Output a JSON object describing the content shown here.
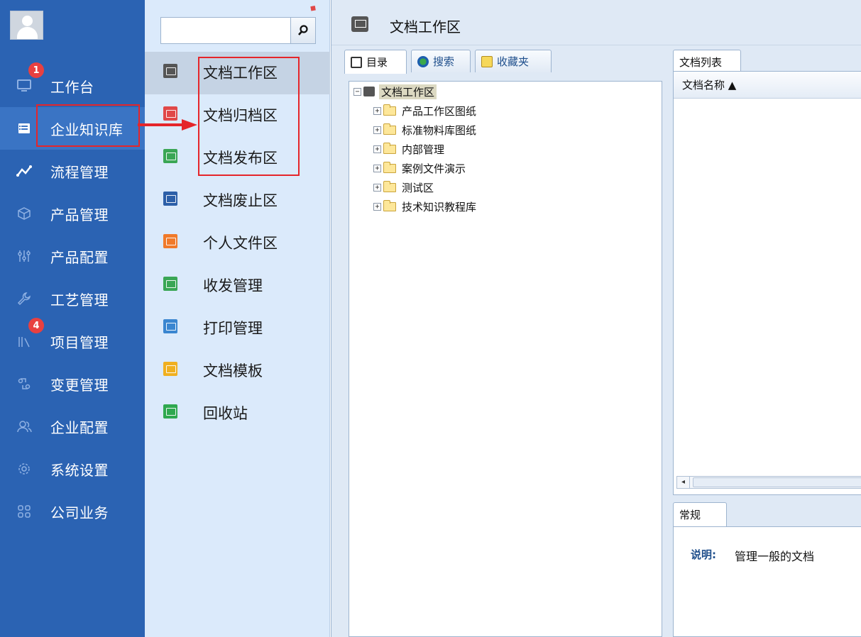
{
  "sidebar": {
    "items": [
      {
        "label": "工作台",
        "icon": "monitor-icon",
        "badge": "1"
      },
      {
        "label": "企业知识库",
        "icon": "book-icon"
      },
      {
        "label": "流程管理",
        "icon": "flow-icon"
      },
      {
        "label": "产品管理",
        "icon": "cube-icon"
      },
      {
        "label": "产品配置",
        "icon": "sliders-icon"
      },
      {
        "label": "工艺管理",
        "icon": "wrench-icon"
      },
      {
        "label": "项目管理",
        "icon": "chart-icon",
        "badge": "4"
      },
      {
        "label": "变更管理",
        "icon": "change-icon"
      },
      {
        "label": "企业配置",
        "icon": "users-icon"
      },
      {
        "label": "系统设置",
        "icon": "gear-icon"
      },
      {
        "label": "公司业务",
        "icon": "grid-icon"
      }
    ]
  },
  "submenu": {
    "search_value": "",
    "items": [
      {
        "label": "文档工作区",
        "icon": "monitor-icon",
        "color": "#555555"
      },
      {
        "label": "文档归档区",
        "icon": "archive-icon",
        "color": "#e04848"
      },
      {
        "label": "文档发布区",
        "icon": "publish-icon",
        "color": "#3aa655"
      },
      {
        "label": "文档废止区",
        "icon": "void-icon",
        "color": "#2c5fa8"
      },
      {
        "label": "个人文件区",
        "icon": "personal-icon",
        "color": "#f07a2a"
      },
      {
        "label": "收发管理",
        "icon": "inbox-icon",
        "color": "#3aa655"
      },
      {
        "label": "打印管理",
        "icon": "print-icon",
        "color": "#3a86d0"
      },
      {
        "label": "文档模板",
        "icon": "template-icon",
        "color": "#f0b020"
      },
      {
        "label": "回收站",
        "icon": "trash-icon",
        "color": "#2fa84f"
      }
    ]
  },
  "main": {
    "title": "文档工作区",
    "left_tabs": [
      {
        "label": "目录"
      },
      {
        "label": "搜索"
      },
      {
        "label": "收藏夹"
      }
    ],
    "tree": {
      "root": "文档工作区",
      "children": [
        "产品工作区图纸",
        "标准物料库图纸",
        "内部管理",
        "案例文件演示",
        "测试区",
        "技术知识教程库"
      ]
    },
    "right_tab": "文档列表",
    "list_column": "文档名称 ▲",
    "detail_tab": "常规",
    "detail": {
      "key": "说明:",
      "value": "管理一般的文档"
    }
  },
  "colors": {
    "nav_bg": "#2b63b3",
    "sub_bg": "#dbeafb",
    "annotation_red": "#e5252a"
  }
}
